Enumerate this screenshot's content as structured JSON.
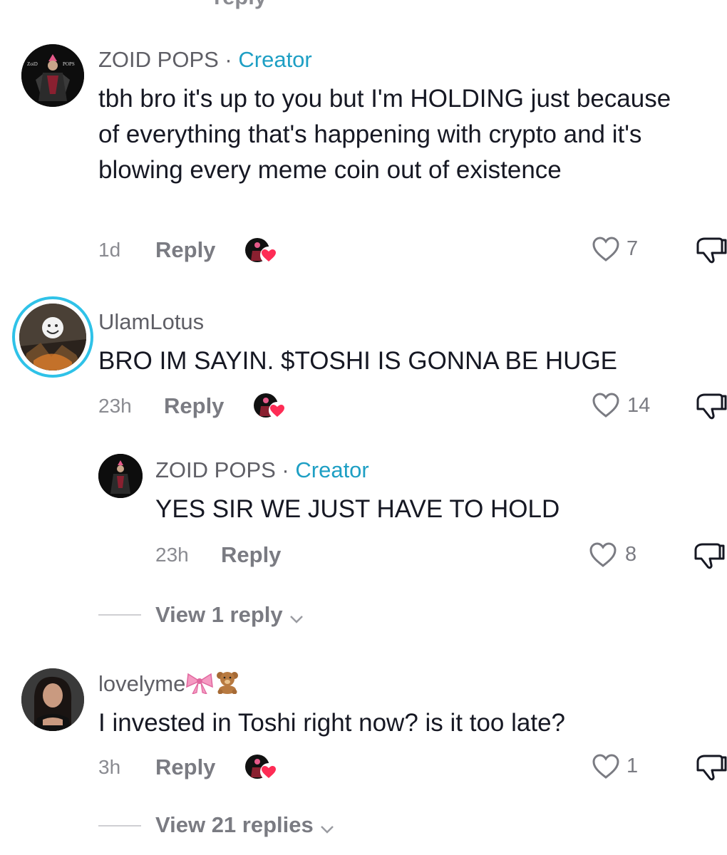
{
  "top_fragment": "reply",
  "comments": [
    {
      "username": "ZOID POPS",
      "separator": " · ",
      "badge": "Creator",
      "avatar_text_left": "ZoiD",
      "avatar_text_right": "POPS",
      "text": "tbh bro it's up to you but I'm HOLDING just because of everything that's happening with crypto and it's blowing every meme coin out of existence",
      "time": "1d",
      "reply_label": "Reply",
      "likes": "7"
    },
    {
      "username": "UlamLotus",
      "text": "BRO IM SAYIN. $TOSHI IS GONNA BE HUGE",
      "time": "23h",
      "reply_label": "Reply",
      "likes": "14"
    },
    {
      "username": "ZOID POPS",
      "separator": " · ",
      "badge": "Creator",
      "text": "YES SIR WE JUST HAVE TO HOLD",
      "time": "23h",
      "reply_label": "Reply",
      "likes": "8"
    },
    {
      "username": "lovelyme",
      "text": "I invested in Toshi right now? is it too late?",
      "time": "3h",
      "reply_label": "Reply",
      "likes": "1"
    }
  ],
  "view_replies": [
    "View 1 reply",
    "View 21 replies"
  ],
  "icons": {
    "like": "heart-outline-icon",
    "dislike": "thumbs-down-icon",
    "creator_liked": "creator-liked-badge-icon",
    "expand": "chevron-down-icon"
  },
  "colors": {
    "creator_badge": "#1e9fc4",
    "liked_heart": "#fe2c55",
    "story_ring": "#2fc2e8"
  }
}
